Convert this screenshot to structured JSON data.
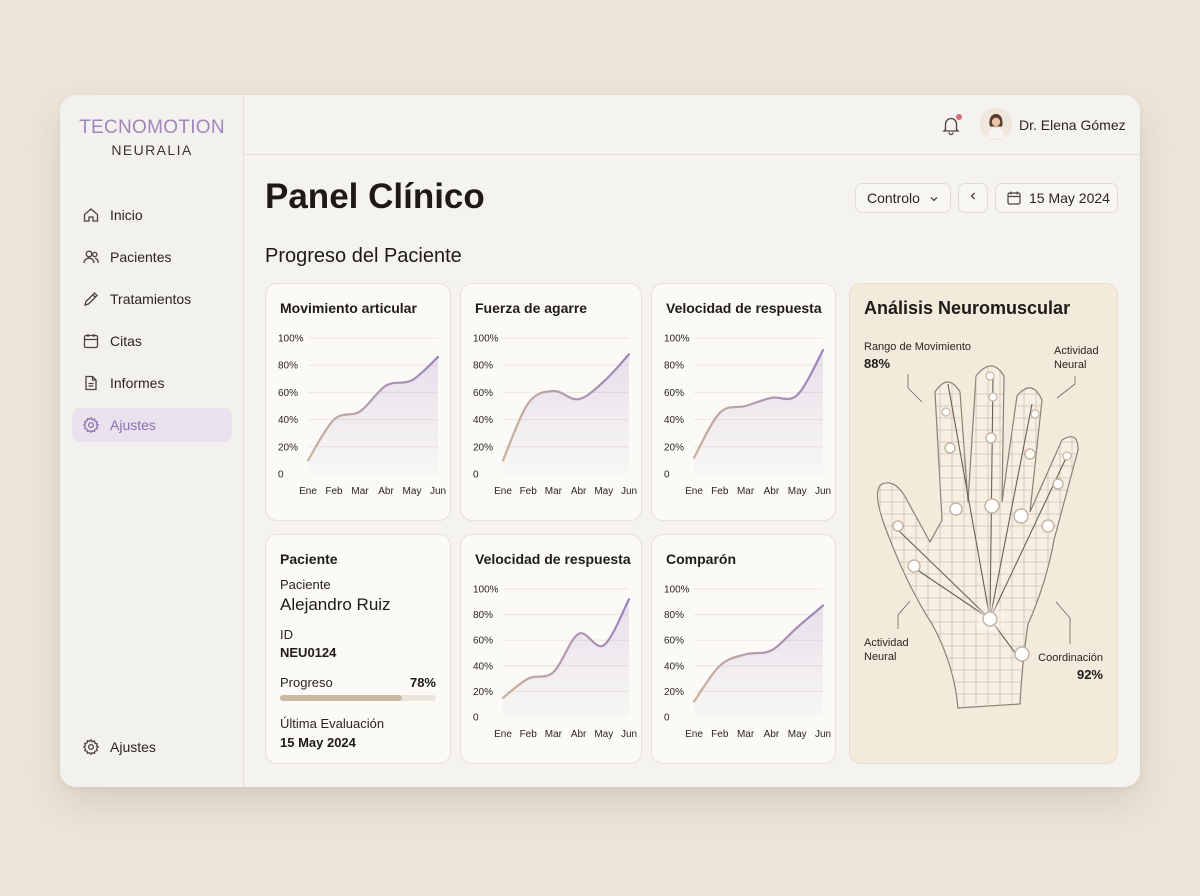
{
  "brand": {
    "name": "TECNOMOTION",
    "sub": "NEURALIA"
  },
  "sidebar": {
    "items": [
      {
        "label": "Inicio",
        "icon": "home-icon"
      },
      {
        "label": "Pacientes",
        "icon": "users-icon"
      },
      {
        "label": "Tratamientos",
        "icon": "pencil-icon"
      },
      {
        "label": "Citas",
        "icon": "calendar-icon"
      },
      {
        "label": "Informes",
        "icon": "document-icon"
      },
      {
        "label": "Ajustes",
        "icon": "gear-icon",
        "active": true
      }
    ],
    "footer_label": "Ajustes"
  },
  "header": {
    "user_name": "Dr. Elena Gómez",
    "notification": true
  },
  "page": {
    "title": "Panel Clínico",
    "section_title": "Progreso del Paciente",
    "select_value": "Controlo",
    "date": "15 May 2024"
  },
  "cards": {
    "c1_title": "Movimiento articular",
    "c2_title": "Fuerza de agarre",
    "c3_title": "Velocidad de respuesta",
    "c4_title": "Velocidad de respuesta",
    "c5_title": "Comparón"
  },
  "patient": {
    "card_title": "Paciente",
    "name_label": "Paciente",
    "name": "Alejandro Ruiz",
    "id_label": "ID",
    "id": "NEU0124",
    "progress_label": "Progreso",
    "progress_text": "78%",
    "progress": 0.78,
    "eval_label": "Última Evaluación",
    "eval_date": "15 May 2024"
  },
  "neuro": {
    "title": "Análisis Neuromuscular",
    "rango_label": "Rango de Movimiento",
    "rango_value": "88%",
    "actividad_top": "Actividad\nNeural",
    "actividad_bottom": "Actividad\nNeural",
    "coord_label": "Coordinación",
    "coord_value": "92%"
  },
  "colors": {
    "accent": "#a186bd",
    "line_start": "#c9b19a",
    "line_end": "#9d83bf",
    "active_nav_bg": "#e9e1ee"
  },
  "chart_data": [
    {
      "type": "area",
      "title": "Movimiento articular",
      "categories": [
        "Ene",
        "Feb",
        "Mar",
        "Abr",
        "May",
        "Jun"
      ],
      "y_ticks": [
        "0",
        "20%",
        "40%",
        "60%",
        "80%",
        "100%"
      ],
      "ylim": [
        0,
        100
      ],
      "series": [
        {
          "values": [
            10,
            40,
            46,
            65,
            69,
            86
          ]
        }
      ]
    },
    {
      "type": "area",
      "title": "Fuerza de agarre",
      "categories": [
        "Ene",
        "Feb",
        "Mar",
        "Abr",
        "May",
        "Jun"
      ],
      "y_ticks": [
        "0",
        "20%",
        "40%",
        "60%",
        "80%",
        "100%"
      ],
      "ylim": [
        0,
        100
      ],
      "series": [
        {
          "values": [
            10,
            52,
            61,
            55,
            68,
            88
          ]
        }
      ]
    },
    {
      "type": "area",
      "title": "Velocidad de respuesta",
      "categories": [
        "Ene",
        "Feb",
        "Mar",
        "Abr",
        "May",
        "Jun"
      ],
      "y_ticks": [
        "0",
        "20%",
        "40%",
        "60%",
        "80%",
        "100%"
      ],
      "ylim": [
        0,
        100
      ],
      "series": [
        {
          "values": [
            12,
            45,
            50,
            56,
            58,
            91
          ]
        }
      ]
    },
    {
      "type": "area",
      "title": "Velocidad de respuesta",
      "categories": [
        "Ene",
        "Feb",
        "Mar",
        "Abr",
        "May",
        "Jun"
      ],
      "y_ticks": [
        "0",
        "20%",
        "40%",
        "60%",
        "80%",
        "100%"
      ],
      "ylim": [
        0,
        100
      ],
      "series": [
        {
          "values": [
            15,
            30,
            35,
            65,
            56,
            92
          ]
        }
      ]
    },
    {
      "type": "area",
      "title": "Comparón",
      "categories": [
        "Ene",
        "Feb",
        "Mar",
        "Abr",
        "May",
        "Jun"
      ],
      "y_ticks": [
        "0",
        "20%",
        "40%",
        "60%",
        "80%",
        "100%"
      ],
      "ylim": [
        0,
        100
      ],
      "series": [
        {
          "values": [
            12,
            40,
            49,
            52,
            70,
            87
          ]
        }
      ]
    }
  ]
}
